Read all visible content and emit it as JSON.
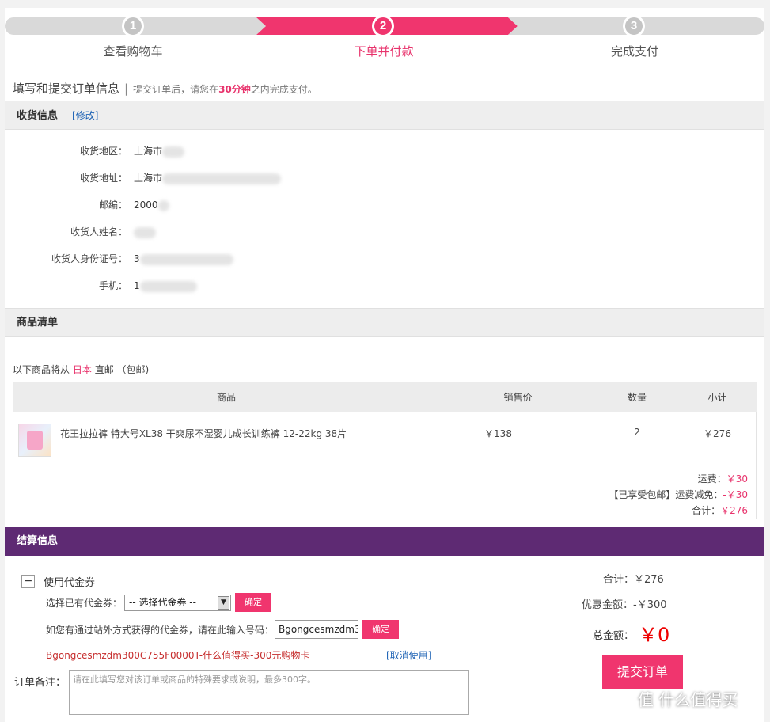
{
  "steps": [
    {
      "num": "1",
      "label": "查看购物车"
    },
    {
      "num": "2",
      "label": "下单并付款"
    },
    {
      "num": "3",
      "label": "完成支付"
    }
  ],
  "heading": {
    "title": "填写和提交订单信息",
    "sep": "|",
    "sub_before": "提交订单后，请您在",
    "sub_highlight": "30分钟",
    "sub_after": "之内完成支付。"
  },
  "address": {
    "section_title": "收货信息",
    "edit_label": "[修改]",
    "rows": [
      {
        "label": "收货地区：",
        "value": "上海市"
      },
      {
        "label": "收货地址：",
        "value": "上海市"
      },
      {
        "label": "邮编：",
        "value": "2000"
      },
      {
        "label": "收货人姓名：",
        "value": ""
      },
      {
        "label": "收货人身份证号：",
        "value": "3"
      },
      {
        "label": "手机：",
        "value": "1"
      }
    ]
  },
  "goods": {
    "section_title": "商品清单",
    "ship_prefix": "以下商品将从",
    "ship_country": "日本",
    "ship_suffix": "直邮 （包邮)",
    "columns": [
      "商品",
      "销售价",
      "数量",
      "小计"
    ],
    "item": {
      "name": "花王拉拉裤 特大号XL38 干爽尿不湿婴儿成长训练裤 12-22kg 38片",
      "price": "￥138",
      "qty": "2",
      "subtotal": "￥276"
    },
    "freight_label": "运费：",
    "freight": "￥30",
    "discount_label": "【已享受包邮】运费减免：",
    "discount": "-￥30",
    "total_label": "合计：",
    "total": "￥276"
  },
  "settle": {
    "section_title": "结算信息",
    "coupon_toggle": "−",
    "coupon_title": "使用代金券",
    "choose_label": "选择已有代金券：",
    "select_value": "-- 选择代金券 --",
    "select_arrow": "▼",
    "confirm1": "确定",
    "code_label": "如您有通过站外方式获得的代金券，请在此输入号码：",
    "code_value": "Bgongcesmzdm3",
    "confirm2": "确定",
    "coupon_used": "Bgongcesmzdm300C755F0000T-什么值得买-300元购物卡",
    "cancel_label": "[取消使用]",
    "remark_label": "订单备注：",
    "remark_placeholder": "请在此填写您对该订单或商品的特殊要求或说明，最多300字。",
    "sum_label": "合计：",
    "sum": "￥276",
    "discount_label": "优惠金额：",
    "discount": "-￥300",
    "grand_label": "总金额：",
    "grand": "￥0",
    "submit_label": "提交订单",
    "watermark": "值 什么值得买"
  },
  "colors": {
    "accent": "#f0356e",
    "purple": "#5e2a73",
    "link": "#1e63b5"
  }
}
